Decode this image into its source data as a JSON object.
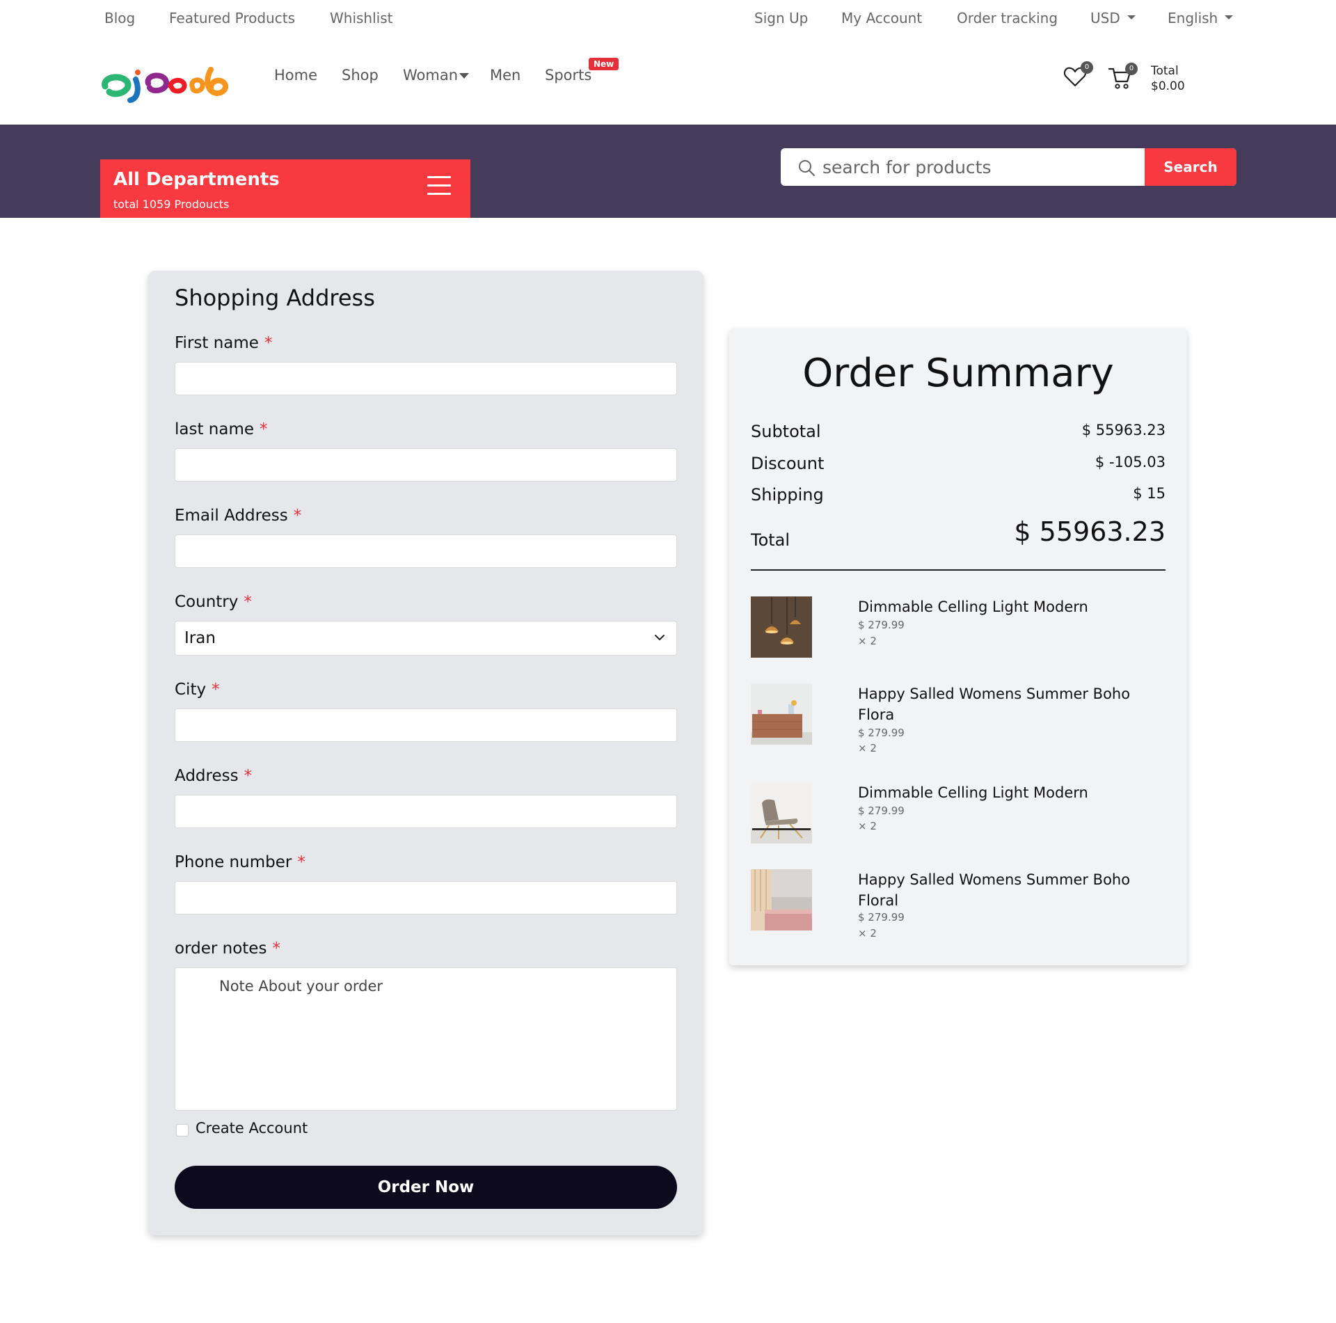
{
  "topbar": {
    "blog": "Blog",
    "featured": "Featured Products",
    "wishlist": "Whishlist",
    "signup": "Sign Up",
    "account": "My Account",
    "tracking": "Order tracking",
    "currency": "USD",
    "language": "English"
  },
  "nav": {
    "home": "Home",
    "shop": "Shop",
    "woman": "Woman",
    "men": "Men",
    "sports": "Sports",
    "new_badge": "New"
  },
  "header": {
    "wishlist_count": "0",
    "cart_count": "0",
    "total_label": "Total",
    "total_value": "$0.00"
  },
  "departments": {
    "title": "All Departments",
    "subtitle": "total 1059 Prodoucts"
  },
  "search": {
    "placeholder": "search for products",
    "button": "Search"
  },
  "form": {
    "title": "Shopping Address",
    "first_name": "First name",
    "last_name": "last name",
    "email": "Email Address",
    "country": "Country",
    "country_value": "Iran",
    "city": "City",
    "address": "Address",
    "phone": "Phone number",
    "notes": "order notes",
    "notes_placeholder": "Note About your order",
    "required_mark": "*",
    "create_account": "Create Account",
    "submit": "Order Now"
  },
  "summary": {
    "title": "Order Summary",
    "subtotal_label": "Subtotal",
    "subtotal_value": "$ 55963.23",
    "discount_label": "Discount",
    "discount_value": "$ -105.03",
    "shipping_label": "Shipping",
    "shipping_value": "$ 15",
    "total_label": "Total",
    "total_value": "$ 55963.23",
    "items": [
      {
        "name": "Dimmable Celling Light Modern",
        "price": "$ 279.99",
        "qty": "× 2",
        "image": "pendant-lights"
      },
      {
        "name": "Happy Salled Womens Summer Boho Flora",
        "price": "$ 279.99",
        "qty": "× 2",
        "image": "wooden-dresser"
      },
      {
        "name": "Dimmable Celling Light Modern",
        "price": "$ 279.99",
        "qty": "× 2",
        "image": "lounge-chair"
      },
      {
        "name": "Happy Salled Womens Summer Boho Floral",
        "price": "$ 279.99",
        "qty": "× 2",
        "image": "pink-bedroom"
      }
    ]
  },
  "colors": {
    "accent_red": "#f8393f",
    "band_purple": "#453c5c",
    "button_dark": "#0d0a1e",
    "card_gray": "#e5e7eb"
  }
}
